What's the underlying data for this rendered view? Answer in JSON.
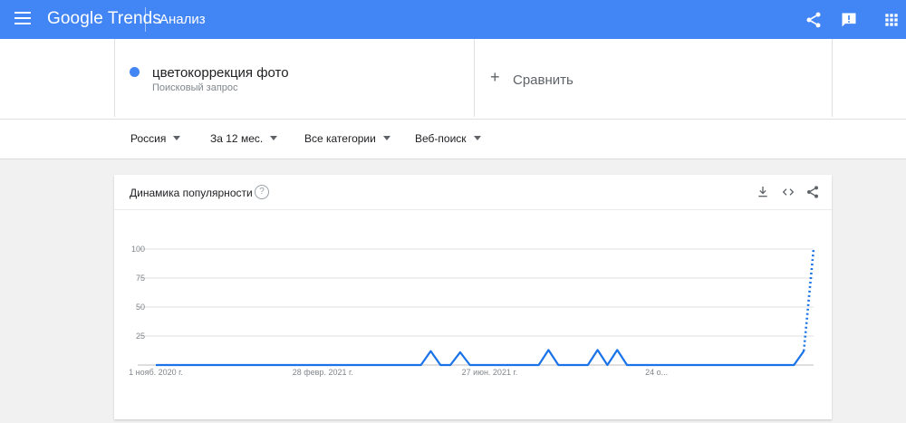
{
  "header": {
    "logo": "Google Trends",
    "section_title": "Анализ",
    "icons": [
      "menu-icon",
      "share-icon",
      "feedback-icon",
      "apps-icon"
    ],
    "background": "#4285f4"
  },
  "search_term": {
    "name": "цветокоррекция фото",
    "type": "Поисковый запрос",
    "dot_color": "#4285f4"
  },
  "compare": {
    "plus": "+",
    "label": "Сравнить"
  },
  "filters": {
    "region": "Россия",
    "period": "За 12 мес.",
    "category": "Все категории",
    "search_type": "Веб-поиск"
  },
  "chart_card": {
    "title": "Динамика популярности",
    "help": "?",
    "icons": [
      "download-icon",
      "embed-icon",
      "share-icon"
    ]
  },
  "chart_data": {
    "type": "line",
    "y_ticks": [
      "100",
      "75",
      "50",
      "25"
    ],
    "ylim": [
      0,
      100
    ],
    "x_labels": [
      {
        "label": "1 нояб. 2020 г.",
        "week": 0
      },
      {
        "label": "28 февр. 2021 г.",
        "week": 17
      },
      {
        "label": "27 июн. 2021 г.",
        "week": 34
      },
      {
        "label": "24 о...",
        "week": 51
      }
    ],
    "series": [
      {
        "color": "#1a73e8",
        "values": [
          0,
          0,
          0,
          0,
          0,
          0,
          0,
          0,
          0,
          0,
          0,
          0,
          0,
          0,
          0,
          0,
          0,
          0,
          0,
          0,
          0,
          0,
          0,
          0,
          0,
          0,
          0,
          0,
          12,
          0,
          0,
          11,
          0,
          0,
          0,
          0,
          0,
          0,
          0,
          0,
          13,
          0,
          0,
          0,
          0,
          13,
          0,
          13,
          0,
          0,
          0,
          0,
          0,
          0,
          0,
          0,
          0,
          0,
          0,
          0,
          0,
          0,
          0,
          0,
          0,
          0,
          12,
          100
        ],
        "dotted_from_index": 66
      }
    ],
    "grid": true
  }
}
